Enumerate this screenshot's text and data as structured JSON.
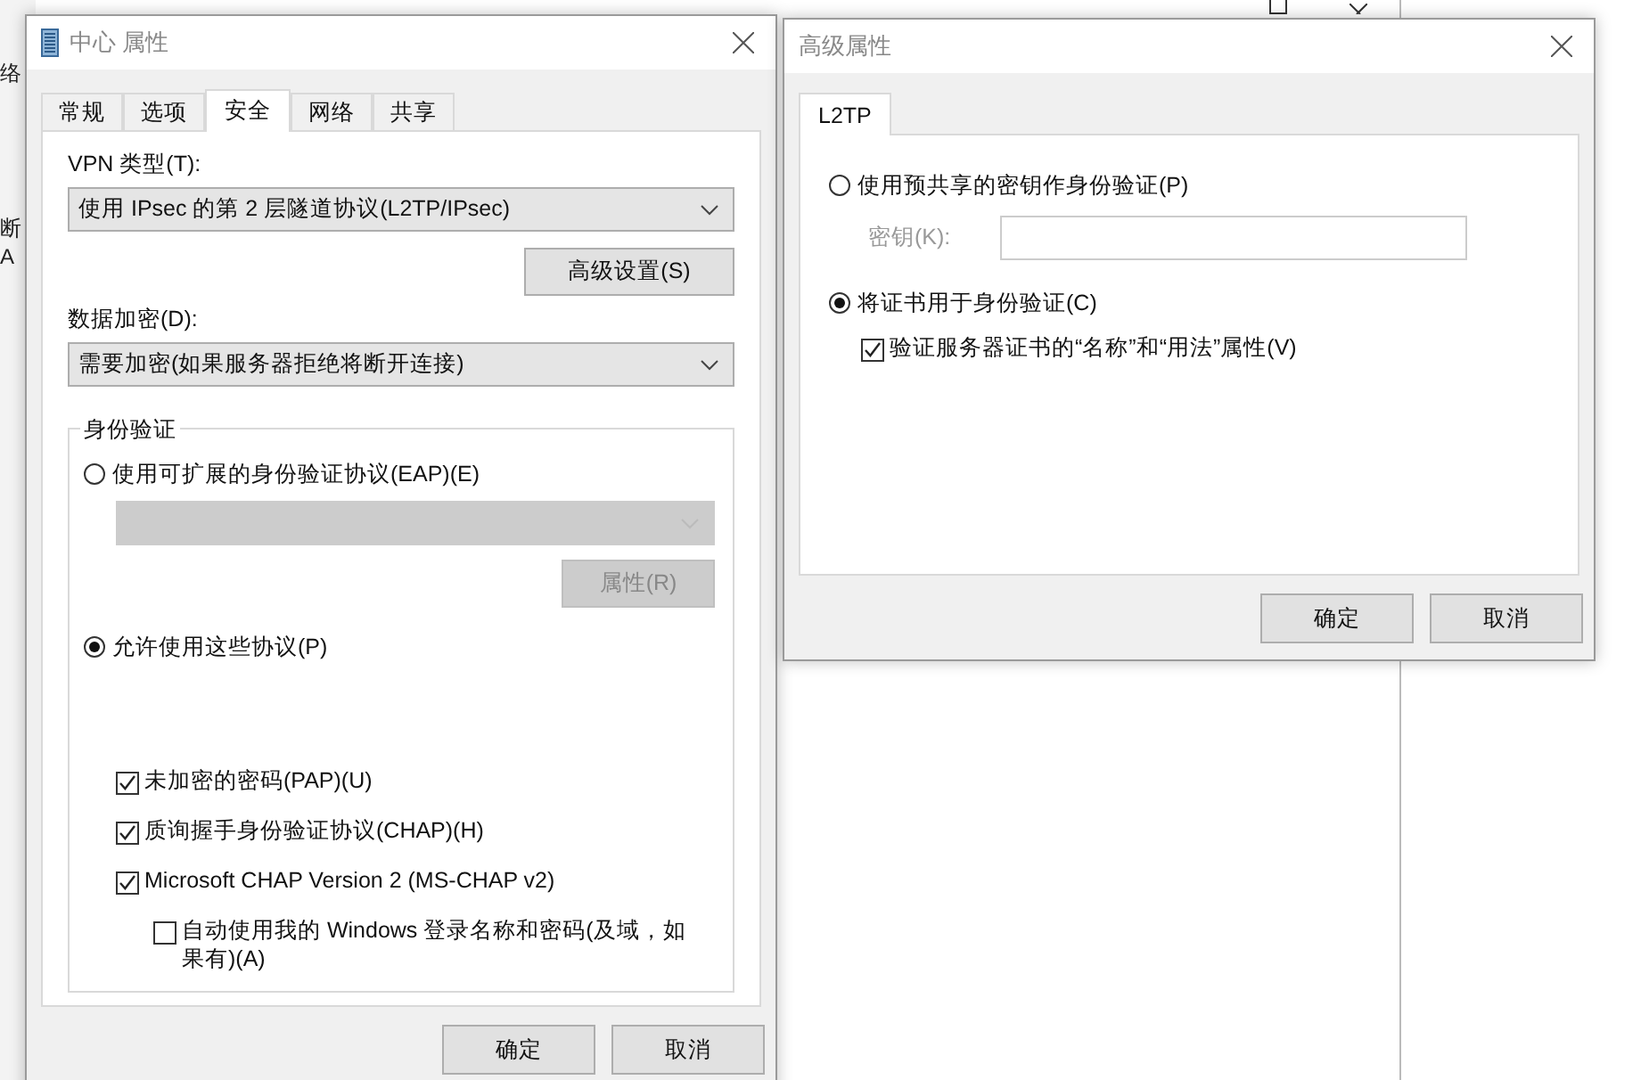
{
  "background": {
    "fragments": [
      "络",
      "断",
      "A"
    ]
  },
  "main_dialog": {
    "title": "中心 属性",
    "tabs": [
      {
        "label": "常规",
        "selected": false
      },
      {
        "label": "选项",
        "selected": false
      },
      {
        "label": "安全",
        "selected": true
      },
      {
        "label": "网络",
        "selected": false
      },
      {
        "label": "共享",
        "selected": false
      }
    ],
    "vpn_type": {
      "label": "VPN 类型(T):",
      "value": "使用 IPsec 的第 2 层隧道协议(L2TP/IPsec)"
    },
    "advanced_button": "高级设置(S)",
    "encryption": {
      "label": "数据加密(D):",
      "value": "需要加密(如果服务器拒绝将断开连接)"
    },
    "authentication": {
      "title": "身份验证",
      "eap_option": {
        "label": "使用可扩展的身份验证协议(EAP)(E)",
        "selected": false
      },
      "eap_dropdown": {
        "disabled": true
      },
      "eap_properties_button": {
        "label": "属性(R)",
        "disabled": true
      },
      "protocols_option": {
        "label": "允许使用这些协议(P)",
        "selected": true
      },
      "protocols": [
        {
          "label": "未加密的密码(PAP)(U)",
          "checked": true
        },
        {
          "label": "质询握手身份验证协议(CHAP)(H)",
          "checked": true
        },
        {
          "label": "Microsoft CHAP Version 2 (MS-CHAP v2)",
          "checked": true,
          "children": [
            {
              "label": "自动使用我的 Windows 登录名称和密码(及域，如果有)(A)",
              "checked": false
            }
          ]
        }
      ]
    },
    "buttons": [
      "确定",
      "取消"
    ]
  },
  "advanced_dialog": {
    "title": "高级属性",
    "tabs": [
      {
        "label": "L2TP",
        "selected": true
      }
    ],
    "psk_option": {
      "label": "使用预共享的密钥作身份验证(P)",
      "selected": false
    },
    "key_field": {
      "label": "密钥(K):",
      "disabled": true
    },
    "cert_option": {
      "label": "将证书用于身份验证(C)",
      "selected": true
    },
    "verify_checkbox": {
      "label": "验证服务器证书的“名称”和“用法”属性(V)",
      "checked": true
    },
    "buttons": [
      "确定",
      "取消"
    ]
  }
}
